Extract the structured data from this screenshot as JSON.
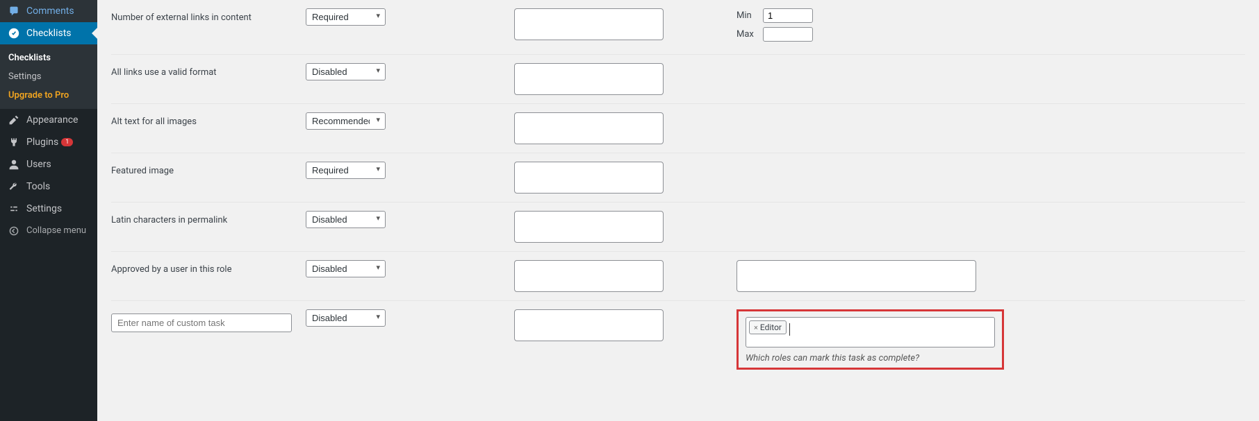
{
  "sidebar": {
    "comments": "Comments",
    "checklists": "Checklists",
    "submenu": {
      "checklists": "Checklists",
      "settings": "Settings",
      "upgrade": "Upgrade to Pro"
    },
    "appearance": "Appearance",
    "plugins": "Plugins",
    "plugins_badge": "1",
    "users": "Users",
    "tools": "Tools",
    "settings": "Settings",
    "collapse": "Collapse menu"
  },
  "rows": {
    "external_links": {
      "label": "Number of external links in content",
      "select": "Required",
      "min_label": "Min",
      "min_value": "1",
      "max_label": "Max",
      "max_value": ""
    },
    "valid_links": {
      "label": "All links use a valid format",
      "select": "Disabled"
    },
    "alt_text": {
      "label": "Alt text for all images",
      "select": "Recommended"
    },
    "featured": {
      "label": "Featured image",
      "select": "Required"
    },
    "latin": {
      "label": "Latin characters in permalink",
      "select": "Disabled"
    },
    "approved": {
      "label": "Approved by a user in this role",
      "select": "Disabled"
    },
    "custom": {
      "placeholder": "Enter name of custom task",
      "select": "Disabled",
      "tag": "Editor",
      "help": "Which roles can mark this task as complete?"
    }
  },
  "select_options": {
    "disabled": "Disabled",
    "required": "Required",
    "recommended": "Recommended"
  }
}
